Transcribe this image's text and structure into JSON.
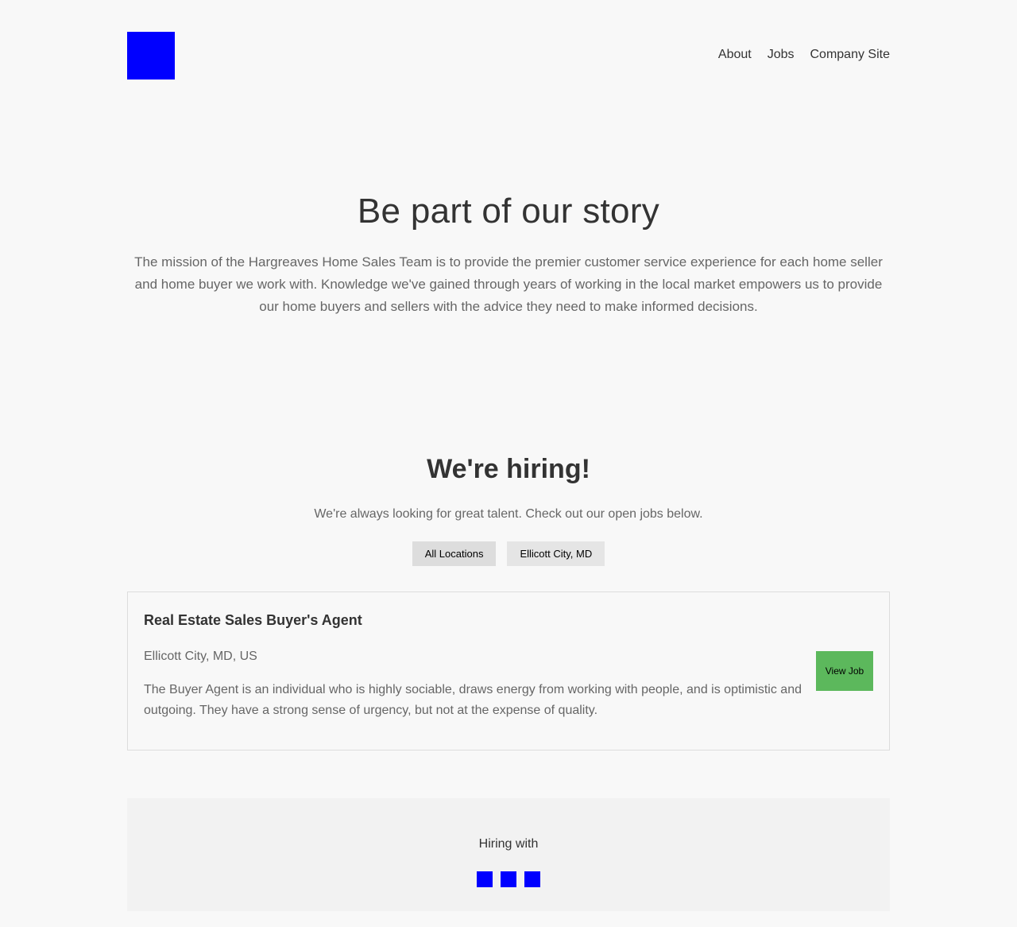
{
  "header": {
    "nav": [
      "About",
      "Jobs",
      "Company Site"
    ],
    "logo_color": "#0000ff"
  },
  "hero": {
    "title": "Be part of our story",
    "text": "The mission of the Hargreaves Home Sales Team is to provide the premier customer service experience for each home seller and home buyer we work with. Knowledge we've gained through years of working in the local market empowers us to provide our home buyers and sellers with the advice they need to make informed decisions."
  },
  "hiring": {
    "title": "We're hiring!",
    "subtitle": "We're always looking for great talent. Check out our open jobs below.",
    "filters": [
      "All Locations",
      "Ellicott City, MD"
    ],
    "selected_filter": "All Locations"
  },
  "jobs": [
    {
      "title": "Real Estate Sales Buyer's Agent",
      "location": "Ellicott City, MD, US",
      "description": "The Buyer Agent is an individual who is highly sociable, draws energy from working with people, and is optimistic and outgoing. They have a strong sense of urgency, but not at the expense of quality.",
      "button": "View Job"
    }
  ],
  "footer": {
    "label": "Hiring with",
    "icon_color": "#0000ff"
  },
  "colors": {
    "accent_button": "#5cb85c",
    "background": "#f8f8f8"
  }
}
